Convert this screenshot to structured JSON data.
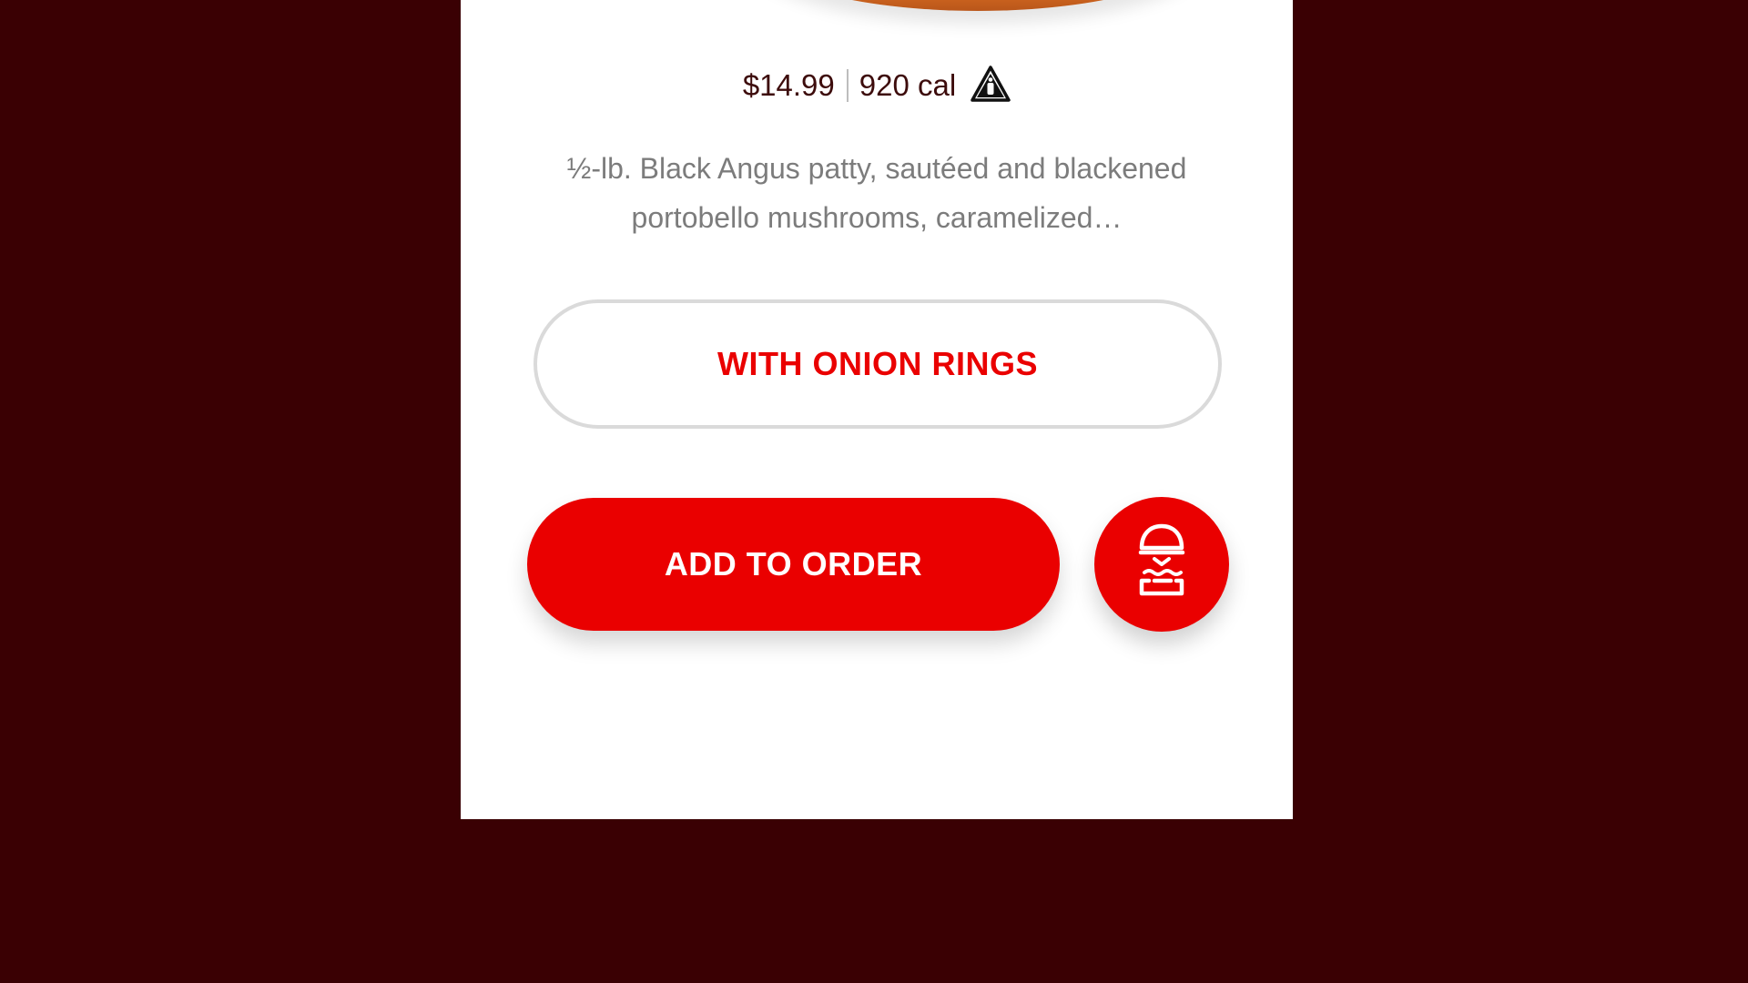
{
  "product": {
    "price": "$14.99",
    "calories": "920 cal",
    "description_line1": "½-lb. Black Angus patty, sautéed and blackened",
    "description_line2": "portobello mushrooms, caramelized…"
  },
  "options": {
    "side_label": "WITH ONION RINGS"
  },
  "actions": {
    "add_to_order_label": "ADD TO ORDER"
  },
  "icons": {
    "allergen": "allergen-warning-icon",
    "burger": "burger-icon"
  },
  "colors": {
    "background": "#3a0003",
    "accent": "#ea0000",
    "card": "#ffffff",
    "price_text": "#3d0c0c",
    "description_text": "#7c7c7c"
  }
}
